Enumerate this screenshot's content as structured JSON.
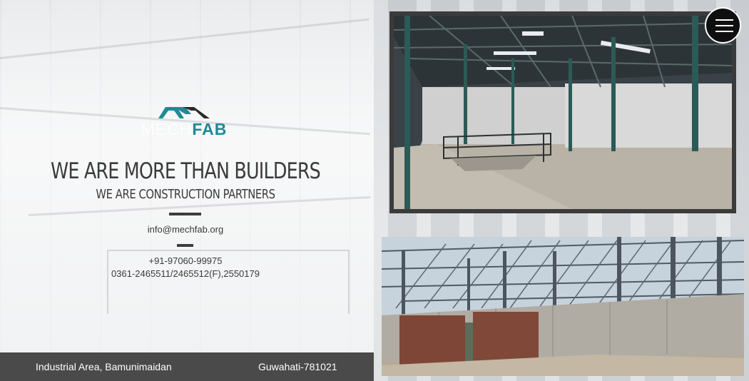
{
  "brand": {
    "logo_word_1": "MECH",
    "logo_word_2": "FAB",
    "accent_color": "#1f8a96"
  },
  "hero": {
    "headline": "WE ARE MORE THAN BUILDERS",
    "subheadline": "WE ARE CONSTRUCTION PARTNERS"
  },
  "contact": {
    "email": "info@mechfab.org",
    "mobile": "+91-97060-99975",
    "landline": "0361-2465511/2465512(F),2550179"
  },
  "footer": {
    "address": "Industrial Area, Bamunimaidan",
    "city": "Guwahati-781021"
  },
  "gallery": {
    "photo_1_subject": "warehouse-interior-steel-structure",
    "photo_2_subject": "steel-frame-construction-site"
  },
  "nav": {
    "menu_icon": "hamburger-menu-icon"
  }
}
